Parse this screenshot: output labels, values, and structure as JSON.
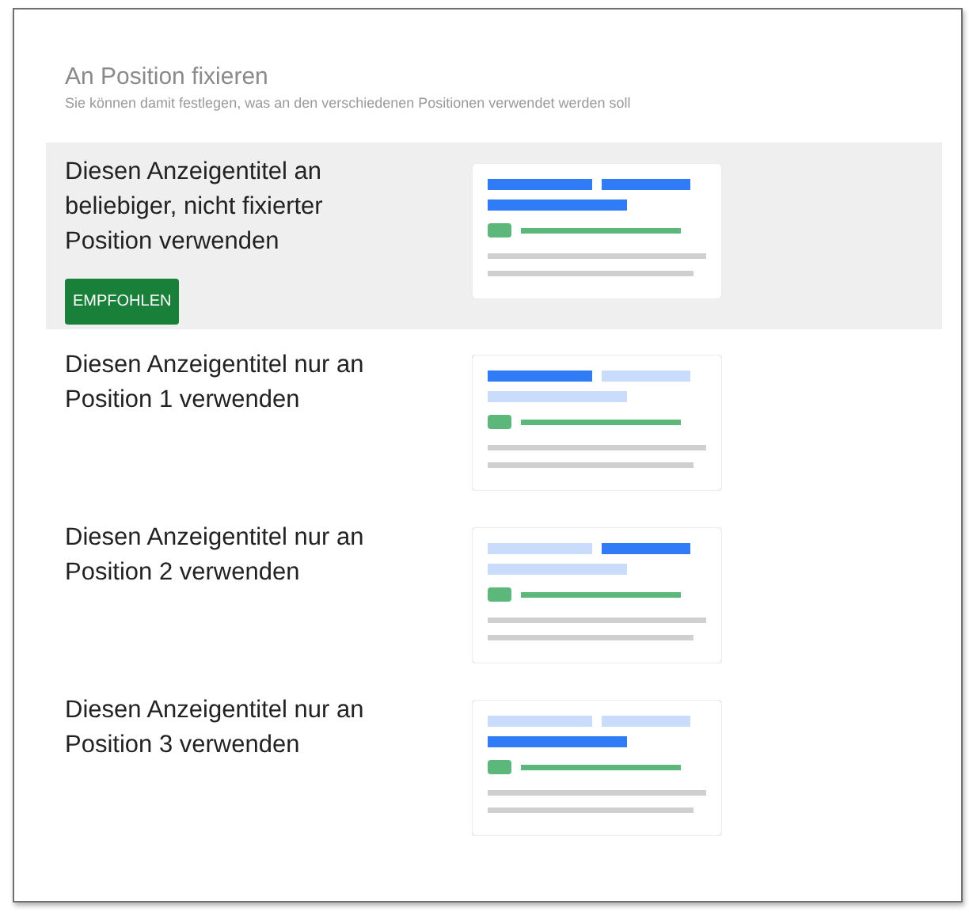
{
  "header": {
    "title": "An Position fixieren",
    "subtitle": "Sie können damit festlegen, was an den verschiedenen Positionen verwendet werden soll"
  },
  "options": [
    {
      "label": "Diesen Anzeigentitel an beliebiger, nicht fixierter Position verwenden",
      "selected": true,
      "badge": "EMPFOHLEN",
      "kind": "all"
    },
    {
      "label": "Diesen Anzeigentitel nur an Position 1 verwenden",
      "selected": false,
      "kind": "first"
    },
    {
      "label": "Diesen Anzeigentitel nur an Position 2 verwenden",
      "selected": false,
      "kind": "second"
    },
    {
      "label": "Diesen Anzeigentitel nur an Position 3 verwenden",
      "selected": false,
      "kind": "third"
    }
  ]
}
